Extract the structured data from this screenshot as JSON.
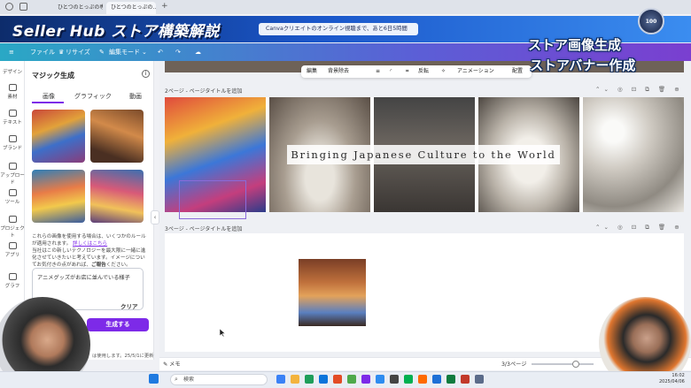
{
  "browser": {
    "tabs": [
      {
        "label": "ひとつのとっぷの専用…"
      },
      {
        "label": "ひとつのとっぷの…"
      }
    ]
  },
  "overlay": {
    "banner_title": "Seller Hub ストア構築解説",
    "countdown": "Canvaクリエイトのオンライン視聴まで、あと6日5時間",
    "medal_number": "100",
    "caption_line1": "ストア画像生成",
    "caption_line2": "ストアバナー作成"
  },
  "menubar": {
    "file": "ファイル",
    "resize": "リサイズ",
    "edit_mode": "編集モード"
  },
  "rail": [
    {
      "label": "デザイン",
      "icon": "design-icon"
    },
    {
      "label": "素材",
      "icon": "elements-icon"
    },
    {
      "label": "テキスト",
      "icon": "text-icon"
    },
    {
      "label": "ブランド",
      "icon": "brand-icon"
    },
    {
      "label": "アップロード",
      "icon": "upload-icon"
    },
    {
      "label": "ツール",
      "icon": "tools-icon"
    },
    {
      "label": "プロジェクト",
      "icon": "projects-icon"
    },
    {
      "label": "アプリ",
      "icon": "apps-icon"
    },
    {
      "label": "グラフ",
      "icon": "chart-icon"
    }
  ],
  "panel": {
    "title": "マジック生成",
    "tabs": [
      "画像",
      "グラフィック",
      "動画"
    ],
    "description": "これらの画像を使用する場合は、いくつかのルールが適用されます。",
    "description_link": "詳しくはこちら",
    "description2": "当社はこの新しいテクノロジーを最大限に一緒に進化させていきたいと考えています。イメージについてお気付きの点があれば、",
    "description2_bold": "ご報告",
    "description2_end": "ください。",
    "prompt": "アニメグッズがお店に並んでいる様子",
    "clear_label": "クリア",
    "generate_label": "生成する",
    "usage_note": "は使用します。25/5/1に更新"
  },
  "toolbar": {
    "edit": "編集",
    "bg_remove": "背景除去",
    "flip": "反転",
    "animate": "アニメーション",
    "position": "配置"
  },
  "canvas": {
    "page2_title": "2ページ - ページタイトルを追加",
    "page3_title": "3ページ - ページタイトルを追加",
    "banner_text": "Bringing Japanese Culture to the World"
  },
  "bottom": {
    "memo": "メモ",
    "page_count": "3/3ページ"
  },
  "taskbar": {
    "search": "検索",
    "time": "16:02",
    "date": "2025/04/06"
  },
  "colors": {
    "accent": "#7d2ae8",
    "banner_blue": "#1a56c9",
    "menubar_start": "#2aa8c5"
  }
}
